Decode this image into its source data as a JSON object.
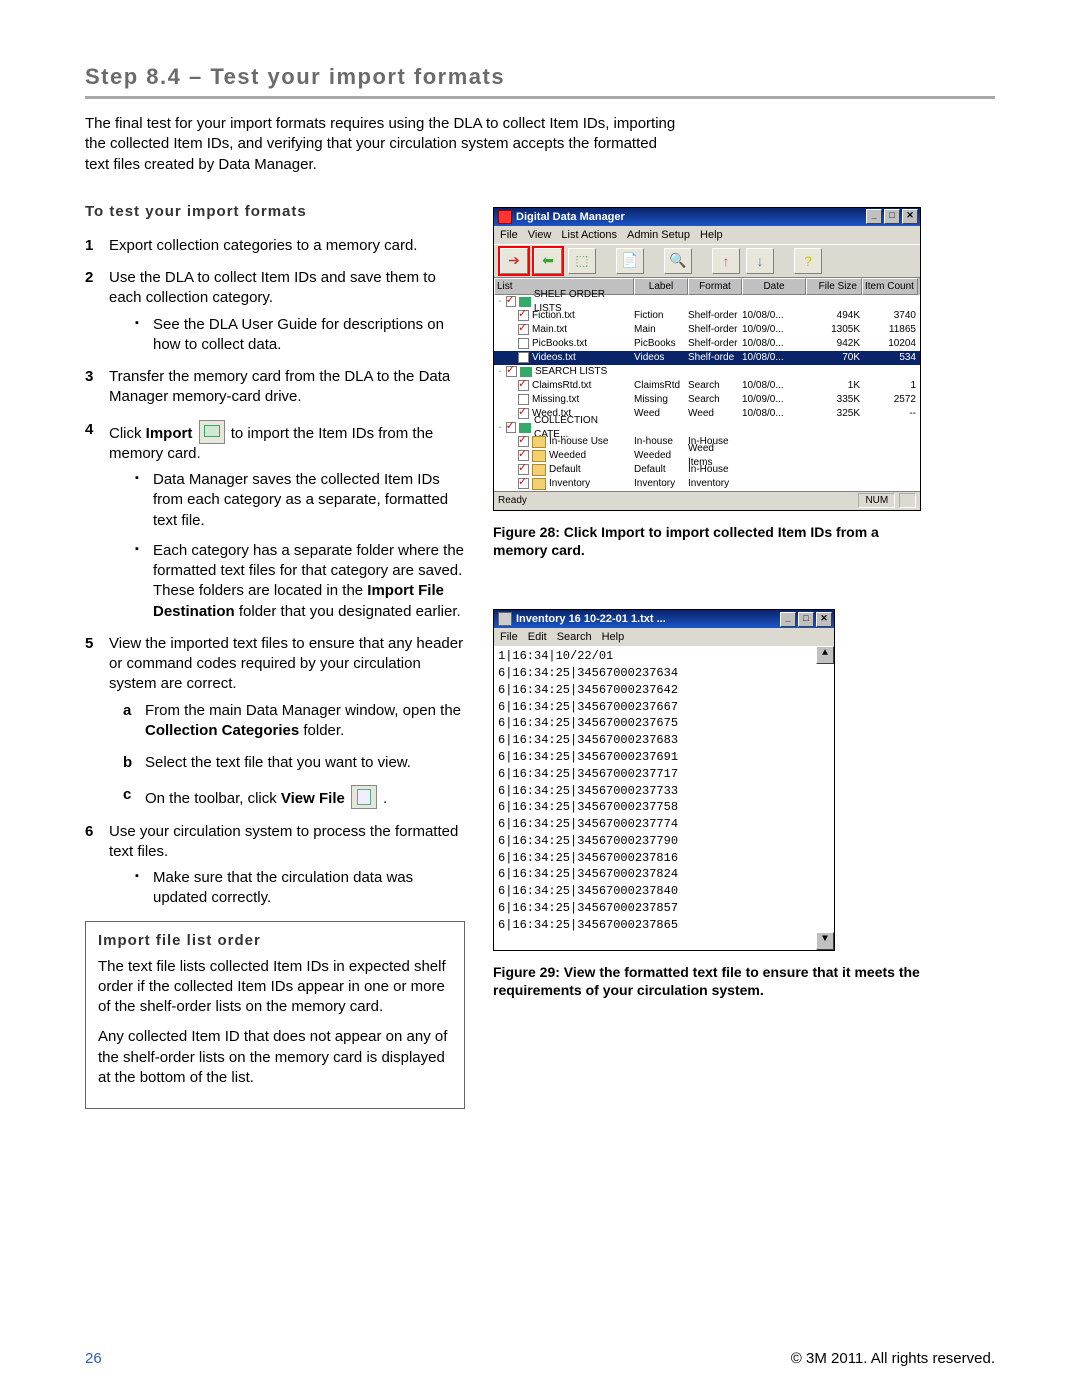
{
  "heading": "Step 8.4 – Test your import formats",
  "intro": "The final test for your import formats requires using the DLA to collect Item IDs, importing the collected Item IDs, and verifying that your circulation system accepts the formatted text files created by Data Manager.",
  "subhead": "To test your import formats",
  "step1": "Export collection categories to a memory card.",
  "step2": "Use the DLA to collect Item IDs and save them to each collection category.",
  "step2_b1": "See the DLA User Guide for descriptions on how to collect data.",
  "step3": "Transfer the memory card from the DLA to the Data Manager memory-card drive.",
  "step4_pre": "Click ",
  "step4_bold": "Import",
  "step4_post": " to import the Item IDs from the memory card.",
  "step4_b1": "Data Manager saves the collected Item IDs from each category as a separate, formatted text file.",
  "step4_b2a": "Each category has a separate folder where the formatted text files for that category are saved. These folders are located in the ",
  "step4_b2b": "Import File Destination",
  "step4_b2c": " folder that you designated earlier.",
  "step5": "View the imported text files to ensure that any header or command codes required by your circulation system are correct.",
  "step5a_a": "From the main Data Manager window, open the ",
  "step5a_b": "Collection Categories",
  "step5a_c": " folder.",
  "step5b": "Select the text file that you want to view.",
  "step5c_a": "On the toolbar, click ",
  "step5c_b": "View File",
  "step5c_c": " .",
  "step6": "Use your circulation system to process the formatted text files.",
  "step6_b1": "Make sure that the circulation data was updated correctly.",
  "callout_title": "Import file list order",
  "callout_p1": "The text file lists collected Item IDs in expected shelf order if the collected Item IDs appear in one or more of the shelf-order lists on the memory card.",
  "callout_p2": "Any collected Item ID that does not appear on any of the shelf-order lists on the memory card is displayed at the bottom of the list.",
  "fig28": "Figure 28: Click Import to import collected Item IDs from a memory card.",
  "fig29": "Figure 29: View the formatted text file to ensure that it meets the requirements of your circulation system.",
  "footer_page": "26",
  "footer_copy": "© 3M 2011. All rights reserved.",
  "app1": {
    "title": "Digital Data Manager",
    "menu": [
      "File",
      "View",
      "List Actions",
      "Admin Setup",
      "Help"
    ],
    "hdr": {
      "list": "List",
      "label": "Label",
      "format": "Format",
      "date": "Date",
      "size": "File Size",
      "count": "Item Count"
    },
    "groups": [
      {
        "name": "SHELF ORDER LISTS",
        "rows": [
          {
            "chk": true,
            "name": "Fiction.txt",
            "label": "Fiction",
            "format": "Shelf-order",
            "date": "10/08/0...",
            "size": "494K",
            "count": "3740"
          },
          {
            "chk": true,
            "name": "Main.txt",
            "label": "Main",
            "format": "Shelf-order",
            "date": "10/09/0...",
            "size": "1305K",
            "count": "11865"
          },
          {
            "chk": false,
            "name": "PicBooks.txt",
            "label": "PicBooks",
            "format": "Shelf-order",
            "date": "10/08/0...",
            "size": "942K",
            "count": "10204"
          },
          {
            "chk": false,
            "name": "Videos.txt",
            "label": "Videos",
            "format": "Shelf-orde",
            "date": "10/08/0...",
            "size": "70K",
            "count": "534",
            "selected": true
          }
        ]
      },
      {
        "name": "SEARCH LISTS",
        "rows": [
          {
            "chk": true,
            "name": "ClaimsRtd.txt",
            "label": "ClaimsRtd",
            "format": "Search",
            "date": "10/08/0...",
            "size": "1K",
            "count": "1"
          },
          {
            "chk": false,
            "name": "Missing.txt",
            "label": "Missing",
            "format": "Search",
            "date": "10/09/0...",
            "size": "335K",
            "count": "2572"
          },
          {
            "chk": true,
            "name": "Weed.txt",
            "label": "Weed",
            "format": "Weed",
            "date": "10/08/0...",
            "size": "325K",
            "count": "--"
          }
        ]
      },
      {
        "name": "COLLECTION CATE...",
        "rows": [
          {
            "chk": true,
            "folder": true,
            "name": "In-house Use",
            "label": "In-house",
            "format": "In-House"
          },
          {
            "chk": true,
            "folder": true,
            "name": "Weeded",
            "label": "Weeded",
            "format": "Weed Items"
          },
          {
            "chk": true,
            "folder": true,
            "name": "Default",
            "label": "Default",
            "format": "In-House",
            "redcheck": true
          },
          {
            "chk": true,
            "folder": true,
            "name": "Inventory",
            "label": "Inventory",
            "format": "Inventory",
            "redcheck": true
          }
        ]
      }
    ],
    "status_left": "Ready",
    "status_right": "NUM"
  },
  "app2": {
    "title": "Inventory 16 10-22-01 1.txt  ...",
    "menu": [
      "File",
      "Edit",
      "Search",
      "Help"
    ],
    "lines": [
      "1|16:34|10/22/01",
      "6|16:34:25|34567000237634",
      "6|16:34:25|34567000237642",
      "6|16:34:25|34567000237667",
      "6|16:34:25|34567000237675",
      "6|16:34:25|34567000237683",
      "6|16:34:25|34567000237691",
      "6|16:34:25|34567000237717",
      "6|16:34:25|34567000237733",
      "6|16:34:25|34567000237758",
      "6|16:34:25|34567000237774",
      "6|16:34:25|34567000237790",
      "6|16:34:25|34567000237816",
      "6|16:34:25|34567000237824",
      "6|16:34:25|34567000237840",
      "6|16:34:25|34567000237857",
      "6|16:34:25|34567000237865"
    ]
  }
}
